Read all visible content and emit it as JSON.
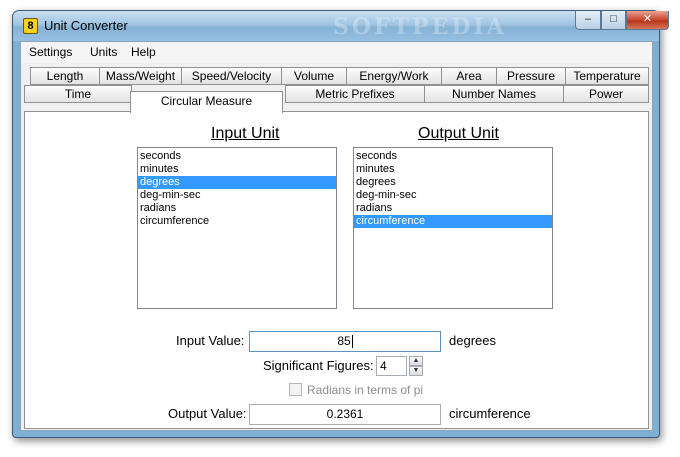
{
  "window": {
    "title": "Unit Converter",
    "watermark": "SOFTPEDIA"
  },
  "controls": {
    "minimize": "–",
    "maximize": "□",
    "close": "✕"
  },
  "menu": [
    "Settings",
    "Units",
    "Help"
  ],
  "tabs_top": [
    "Length",
    "Mass/Weight",
    "Speed/Velocity",
    "Volume",
    "Energy/Work",
    "Area",
    "Pressure",
    "Temperature"
  ],
  "tabs_bottom": [
    "Time",
    "Circular Measure",
    "Metric Prefixes",
    "Number Names",
    "Power"
  ],
  "active_tab": "Circular Measure",
  "input_unit": {
    "title": "Input Unit",
    "items": [
      "seconds",
      "minutes",
      "degrees",
      "deg-min-sec",
      "radians",
      "circumference"
    ],
    "selected": "degrees"
  },
  "output_unit": {
    "title": "Output Unit",
    "items": [
      "seconds",
      "minutes",
      "degrees",
      "deg-min-sec",
      "radians",
      "circumference"
    ],
    "selected": "circumference"
  },
  "form": {
    "input_label": "Input Value:",
    "input_value": "85",
    "input_unit": "degrees",
    "sigfig_label": "Significant Figures:",
    "sigfig_value": "4",
    "radians_pi_label": "Radians in terms of pi",
    "radians_pi_checked": false,
    "output_label": "Output Value:",
    "output_value": "0.2361",
    "output_unit": "circumference"
  }
}
